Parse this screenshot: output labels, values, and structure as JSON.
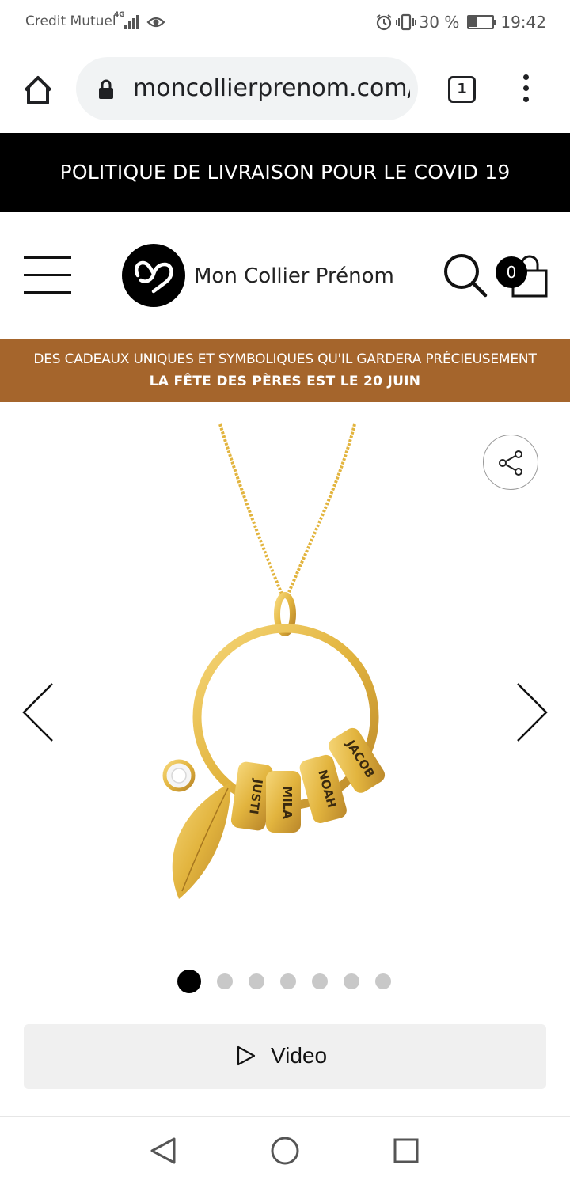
{
  "status_bar": {
    "carrier": "Credit Mutuel",
    "network": "4G",
    "battery": "30 %",
    "battery_level": 0.3,
    "time": "19:42"
  },
  "browser": {
    "url": "moncollierprenom.com/",
    "tab_count": "1"
  },
  "covid_banner": "POLITIQUE DE LIVRAISON POUR LE COVID 19",
  "header": {
    "site_name": "Mon Collier Prénom",
    "cart_count": "0"
  },
  "promo": {
    "line1": "DES CADEAUX UNIQUES ET SYMBOLIQUES QU'IL GARDERA PRÉCIEUSEMENT",
    "line2": "LA FÊTE DES PÈRES EST LE 20 JUIN"
  },
  "product": {
    "bead_names": [
      "JUSTI",
      "MILA",
      "NOAH",
      "JACOB"
    ],
    "image_count": 7,
    "active_image": 1,
    "video_label": "Video"
  },
  "colors": {
    "promo_bg": "#a5652c",
    "banner_bg": "#000000",
    "gold": "#e2b43e"
  }
}
